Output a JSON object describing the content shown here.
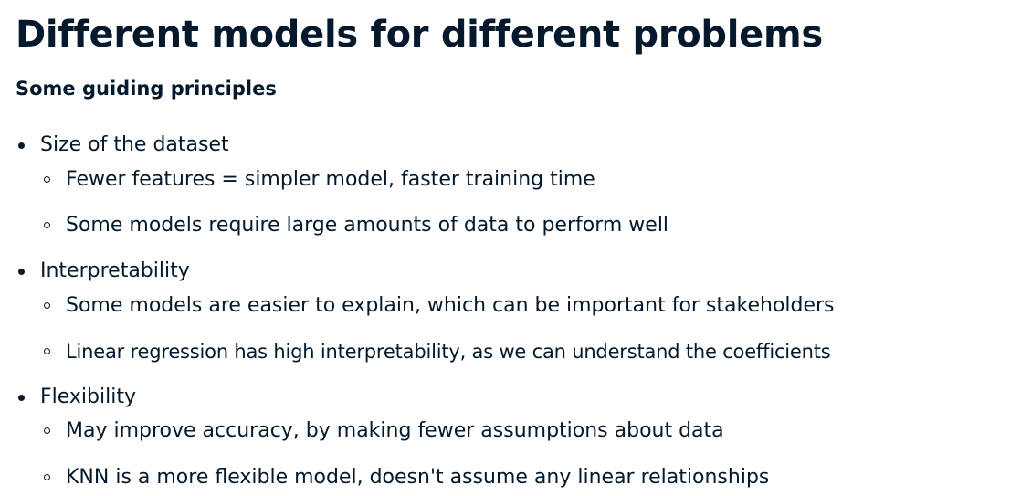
{
  "slide": {
    "title": "Different models for different problems",
    "subtitle": "Some guiding principles",
    "sections": [
      {
        "heading": "Size of the dataset",
        "points": [
          "Fewer features = simpler model, faster training time",
          "Some models require large amounts of data to perform well"
        ]
      },
      {
        "heading": "Interpretability",
        "points": [
          "Some models are easier to explain, which can be important for stakeholders",
          "Linear regression has high interpretability, as we can understand the coefficients"
        ]
      },
      {
        "heading": "Flexibility",
        "points": [
          "May improve accuracy, by making fewer assumptions about data",
          "KNN is a more flexible model, doesn't assume any linear relationships"
        ]
      }
    ]
  }
}
